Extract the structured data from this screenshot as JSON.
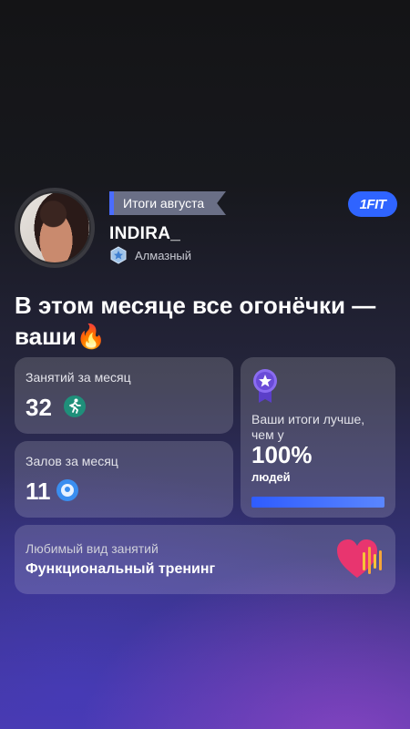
{
  "header": {
    "period_label": "Итоги августа",
    "brand": "1FIT",
    "username": "INDIRA_",
    "level": "Алмазный"
  },
  "headline": "В этом месяце все огонёчки — ваши🔥",
  "stats": {
    "sessions": {
      "label": "Занятий за месяц",
      "value": "32",
      "icon": "running-person-icon"
    },
    "gyms": {
      "label": "Залов за месяц",
      "value": "11",
      "icon": "location-pin-icon"
    },
    "ranking": {
      "label": "Ваши итоги лучше, чем у",
      "percent": "100%",
      "unit": "людей",
      "progress": 1.0,
      "icon": "star-medal-icon"
    }
  },
  "favorite": {
    "label": "Любимый вид занятий",
    "value": "Функциональный тренинг",
    "icon": "heart-pulse-icon"
  },
  "colors": {
    "accent": "#2f64ff",
    "medal": "#6a4bd8",
    "heart": "#e8356f"
  }
}
